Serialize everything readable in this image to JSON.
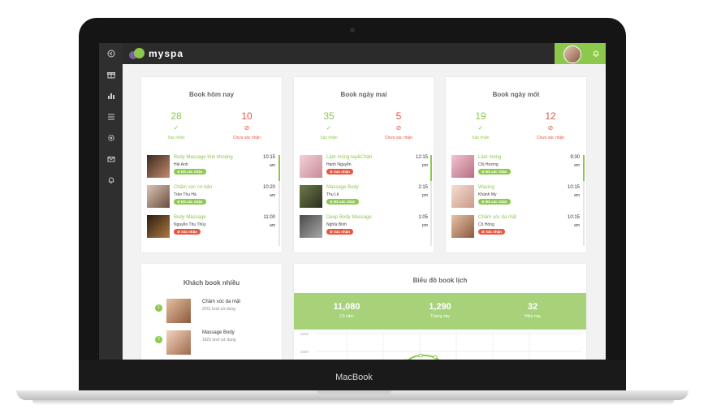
{
  "device": {
    "label": "MacBook"
  },
  "colors": {
    "accent_green": "#8cc84b",
    "accent_red": "#e8553e",
    "sidebar": "#2f2f2f",
    "topbar": "#2b2b2b"
  },
  "topbar": {
    "brand": "myspa",
    "bell_icon": "bell-icon",
    "avatar_icon": "avatar"
  },
  "sidebar": {
    "items": [
      {
        "icon": "back-arrow-icon"
      },
      {
        "icon": "gift-icon"
      },
      {
        "icon": "bar-chart-icon"
      },
      {
        "icon": "list-icon"
      },
      {
        "icon": "gear-icon"
      },
      {
        "icon": "mail-icon"
      },
      {
        "icon": "bell-icon"
      }
    ]
  },
  "panels": [
    {
      "title": "Book hôm nay",
      "confirmed_count": "28",
      "confirmed_label": "Xác nhận",
      "pending_count": "10",
      "pending_label": "Chưa xác nhận",
      "bookings": [
        {
          "service": "Body Massage bùn khoáng",
          "customer": "Hải Anh",
          "time": "10:15",
          "ampm": "am",
          "status": "Đã xác nhận",
          "status_type": "ok"
        },
        {
          "service": "Chăm sóc cơ bản",
          "customer": "Trần Thu Hà",
          "time": "10:20",
          "ampm": "am",
          "status": "Đã xác nhận",
          "status_type": "ok"
        },
        {
          "service": "Body Massage",
          "customer": "Nguyễn Thu Thủy",
          "time": "11:00",
          "ampm": "am",
          "status": "Xác nhận",
          "status_type": "no"
        }
      ]
    },
    {
      "title": "Book ngày mai",
      "confirmed_count": "35",
      "confirmed_label": "Xác nhận",
      "pending_count": "5",
      "pending_label": "Chưa xác nhận",
      "bookings": [
        {
          "service": "Làm móng tay&Chân",
          "customer": "Hạnh Nguyễn",
          "time": "12:15",
          "ampm": "pm",
          "status": "Xác nhận",
          "status_type": "no"
        },
        {
          "service": "Massage Body",
          "customer": "Thu Lê",
          "time": "2:15",
          "ampm": "pm",
          "status": "Đã xác nhận",
          "status_type": "ok"
        },
        {
          "service": "Deep Body Massage",
          "customer": "Nghĩa Bình",
          "time": "1:05",
          "ampm": "pm",
          "status": "Xác nhận",
          "status_type": "no"
        }
      ]
    },
    {
      "title": "Book ngày mốt",
      "confirmed_count": "19",
      "confirmed_label": "Xác nhận",
      "pending_count": "12",
      "pending_label": "Chưa xác nhận",
      "bookings": [
        {
          "service": "Làm móng",
          "customer": "Chị Hương",
          "time": "9:30",
          "ampm": "am",
          "status": "Đã xác nhận",
          "status_type": "ok"
        },
        {
          "service": "Waxing",
          "customer": "Khánh My",
          "time": "10:15",
          "ampm": "am",
          "status": "Đã xác nhận",
          "status_type": "ok"
        },
        {
          "service": "Chăm sóc da mặt",
          "customer": "Cô Hồng",
          "time": "10:15",
          "ampm": "am",
          "status": "Xác nhận",
          "status_type": "no"
        }
      ]
    }
  ],
  "top_services": {
    "title": "Khách book nhiều",
    "items": [
      {
        "rank": "1",
        "name": "Chăm sóc da mặt",
        "count": "2011 lượt sử dụng"
      },
      {
        "rank": "2",
        "name": "Massage Body",
        "count": "1822 lượt sử dụng"
      }
    ]
  },
  "booking_chart": {
    "title": "Biểu đồ book lịch",
    "stats": [
      {
        "value": "11,080",
        "label": "Cả năm"
      },
      {
        "value": "1,290",
        "label": "Tháng này"
      },
      {
        "value": "32",
        "label": "Hôm nay"
      }
    ],
    "y_ticks": [
      "2500",
      "2000"
    ]
  }
}
